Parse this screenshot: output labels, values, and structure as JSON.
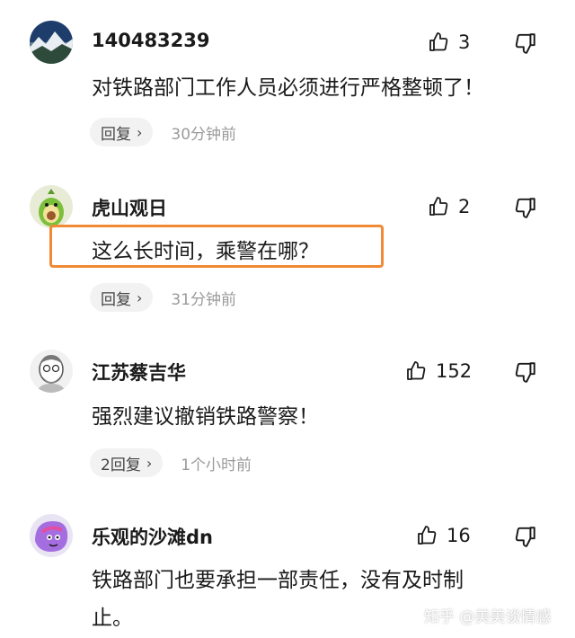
{
  "comments": [
    {
      "username": "140483239",
      "likes": "3",
      "text": "对铁路部门工作人员必须进行严格整顿了！",
      "reply_label": "回复",
      "time": "30分钟前"
    },
    {
      "username": "虎山观日",
      "likes": "2",
      "text": "这么长时间，乘警在哪？",
      "reply_label": "回复",
      "time": "31分钟前"
    },
    {
      "username": "江苏蔡吉华",
      "likes": "152",
      "text": "强烈建议撤销铁路警察！",
      "reply_label": "2回复",
      "time": "1个小时前"
    },
    {
      "username": "乐观的沙滩dn",
      "likes": "16",
      "text_line1": "铁路部门也要承担一部责任，没有及时制",
      "text_line2": "止。"
    }
  ],
  "watermark": "知乎 @美美谈情感",
  "colors": {
    "highlight": "#f08a34",
    "reply_bg": "#f2f2f2",
    "timestamp": "#9a9a9a"
  }
}
